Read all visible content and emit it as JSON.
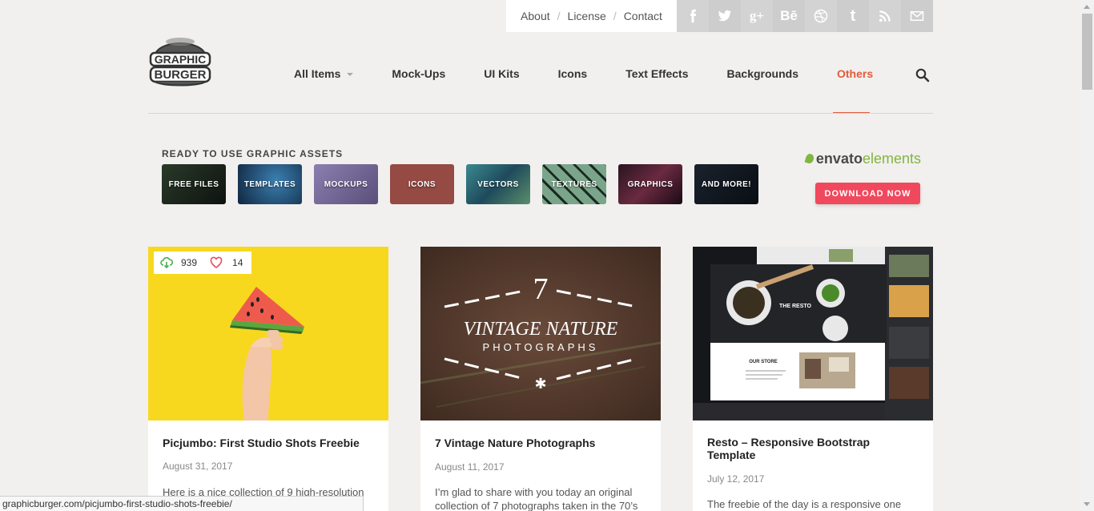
{
  "toplinks": [
    "About",
    "License",
    "Contact"
  ],
  "social": [
    {
      "icon": "facebook-icon",
      "glyph": "f",
      "color": "#d3d3d3"
    },
    {
      "icon": "twitter-icon",
      "glyph": "t",
      "color": "#cdcdcd"
    },
    {
      "icon": "google-plus-icon",
      "glyph": "g+",
      "color": "#d3d3d3"
    },
    {
      "icon": "behance-icon",
      "glyph": "Bē",
      "color": "#cdcdcd"
    },
    {
      "icon": "dribbble-icon",
      "glyph": "◎",
      "color": "#d3d3d3"
    },
    {
      "icon": "tumblr-icon",
      "glyph": "t",
      "color": "#cdcdcd"
    },
    {
      "icon": "rss-icon",
      "glyph": "rss",
      "color": "#d3d3d3"
    },
    {
      "icon": "mail-icon",
      "glyph": "✉",
      "color": "#cdcdcd"
    }
  ],
  "logo": {
    "line1": "GRAPHIC",
    "line2": "BURGER"
  },
  "nav": {
    "items": [
      "All Items",
      "Mock-Ups",
      "UI Kits",
      "Icons",
      "Text Effects",
      "Backgrounds",
      "Others"
    ],
    "active": "Others"
  },
  "assets": {
    "title": "READY TO USE GRAPHIC ASSETS",
    "tiles": [
      {
        "label": "FREE FILES",
        "bg": "#1b1f1a"
      },
      {
        "label": "TEMPLATES",
        "bg": "#1e4a6e"
      },
      {
        "label": "MOCKUPS",
        "bg": "#6b5f8c"
      },
      {
        "label": "ICONS",
        "bg": "#954a44"
      },
      {
        "label": "VECTORS",
        "bg": "#2f6f7a"
      },
      {
        "label": "TEXTURES",
        "bg": "#6f9b7e"
      },
      {
        "label": "GRAPHICS",
        "bg": "#3a2030"
      },
      {
        "label": "AND MORE!",
        "bg": "#121820"
      }
    ]
  },
  "envato": {
    "part1": "envato",
    "part2": "elements",
    "button": "DOWNLOAD NOW"
  },
  "cards": [
    {
      "title": "Picjumbo: First Studio Shots Freebie",
      "date": "August 31, 2017",
      "excerpt": "Here is a nice collection of 9 high-resolution",
      "downloads": "939",
      "likes": "14"
    },
    {
      "title": "7 Vintage Nature Photographs",
      "date": "August 11, 2017",
      "excerpt": "I’m glad to share with you today an original collection of 7 photographs taken in the 70’s",
      "thumb_number": "7",
      "thumb_line1": "VINTAGE NATURE",
      "thumb_line2": "PHOTOGRAPHS"
    },
    {
      "title": "Resto – Responsive Bootstrap Template",
      "date": "July 12, 2017",
      "excerpt": "The freebie of the day is a responsive one",
      "thumb_brand": "THE RESTO",
      "thumb_store": "OUR STORE"
    }
  ],
  "statusbar": "graphicburger.com/picjumbo-first-studio-shots-freebie/"
}
